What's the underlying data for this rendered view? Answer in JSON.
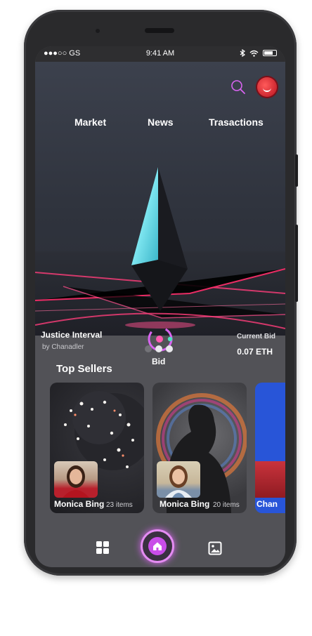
{
  "statusbar": {
    "carrier": "●●●○○ GS",
    "time": "9:41 AM"
  },
  "header": {
    "tabs": [
      "Market",
      "News",
      "Trasactions"
    ]
  },
  "featured": {
    "title": "Justice Interval",
    "artist": "by Chanadler",
    "bid_label": "Bid",
    "current_bid_label": "Current Bid",
    "current_bid_value": "0.07 ETH",
    "carousel_pages": 3,
    "carousel_active": 1
  },
  "top_sellers": {
    "title": "Top Sellers",
    "cards": [
      {
        "name": "Monica Bing",
        "items": "23 items"
      },
      {
        "name": "Monica Bing",
        "items": "20 items"
      },
      {
        "name": "Chan",
        "items": ""
      }
    ]
  },
  "colors": {
    "accent": "#d864f0",
    "hero_bg": "#32363f",
    "screen_bg": "#525257"
  },
  "bottom_nav": {
    "items": [
      "grid-icon",
      "home-icon",
      "gallery-icon"
    ]
  }
}
